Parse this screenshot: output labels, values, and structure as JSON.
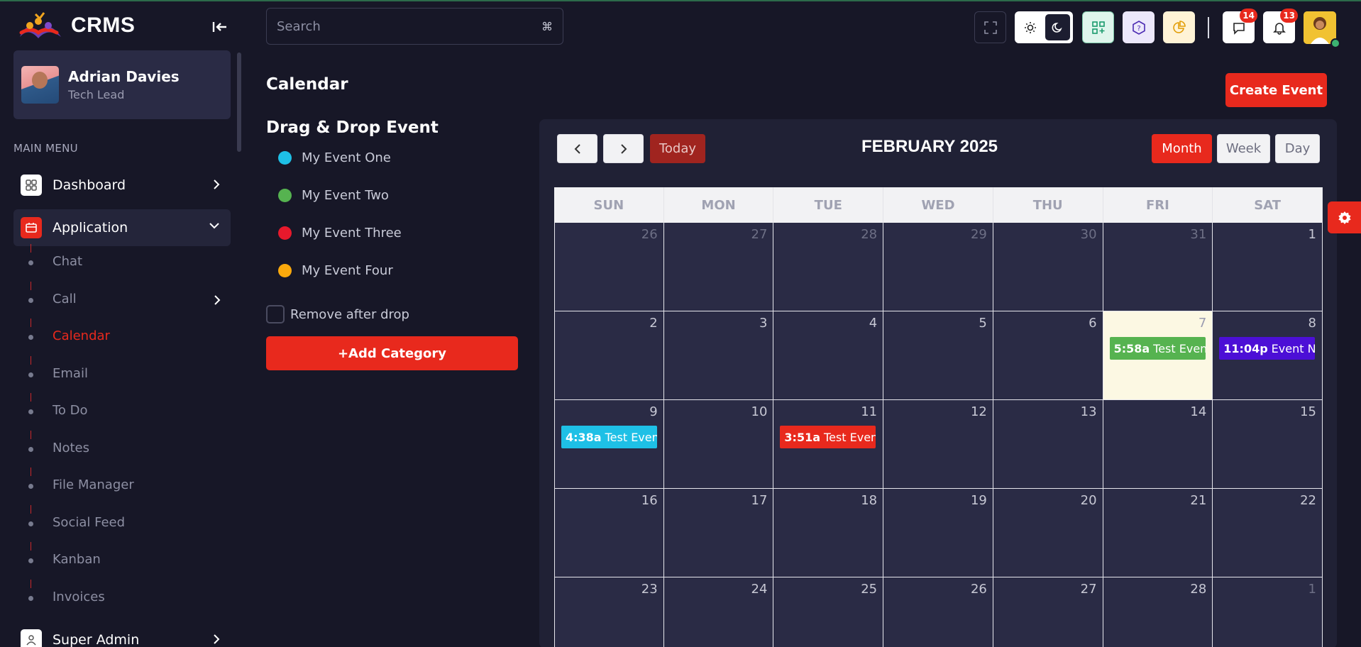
{
  "brand": {
    "name": "CRMS"
  },
  "profile": {
    "name": "Adrian Davies",
    "role": "Tech Lead"
  },
  "sidebar": {
    "section_title": "MAIN MENU",
    "items": [
      {
        "label": "Dashboard",
        "icon": "dashboard-icon"
      },
      {
        "label": "Application",
        "icon": "application-icon"
      },
      {
        "label": "Super Admin",
        "icon": "super-admin-icon"
      }
    ],
    "submenu": [
      {
        "label": "Chat"
      },
      {
        "label": "Call"
      },
      {
        "label": "Calendar"
      },
      {
        "label": "Email"
      },
      {
        "label": "To Do"
      },
      {
        "label": "Notes"
      },
      {
        "label": "File Manager"
      },
      {
        "label": "Social Feed"
      },
      {
        "label": "Kanban"
      },
      {
        "label": "Invoices"
      }
    ]
  },
  "search": {
    "placeholder": "Search",
    "shortcut": "⌘"
  },
  "topbar": {
    "messages_count": "14",
    "notifications_count": "13",
    "colors": {
      "accent": "#e8291d"
    }
  },
  "page": {
    "title": "Calendar",
    "create_button": "Create Event"
  },
  "drag_drop": {
    "title": "Drag & Drop Event",
    "events": [
      {
        "label": "My Event One",
        "color": "#1ec0e6"
      },
      {
        "label": "My Event Two",
        "color": "#56b350"
      },
      {
        "label": "My Event Three",
        "color": "#e8192c"
      },
      {
        "label": "My Event Four",
        "color": "#fba90c"
      }
    ],
    "remove_label": "Remove after drop",
    "add_category": "+Add Category"
  },
  "calendar": {
    "month_title": "FEBRUARY 2025",
    "today_label": "Today",
    "views": [
      "Month",
      "Week",
      "Day"
    ],
    "active_view": "Month",
    "weekdays": [
      "SUN",
      "MON",
      "TUE",
      "WED",
      "THU",
      "FRI",
      "SAT"
    ],
    "weeks": [
      [
        "26",
        "27",
        "28",
        "29",
        "30",
        "31",
        "1"
      ],
      [
        "2",
        "3",
        "4",
        "5",
        "6",
        "7",
        "8"
      ],
      [
        "9",
        "10",
        "11",
        "12",
        "13",
        "14",
        "15"
      ],
      [
        "16",
        "17",
        "18",
        "19",
        "20",
        "21",
        "22"
      ],
      [
        "23",
        "24",
        "25",
        "26",
        "27",
        "28",
        "1"
      ]
    ],
    "events": [
      {
        "day": "7",
        "week": 1,
        "col": 5,
        "time": "5:58a",
        "title": "Test Event",
        "color": "#56b350"
      },
      {
        "day": "8",
        "week": 1,
        "col": 6,
        "time": "11:04p",
        "title": "Event Na",
        "color": "#4c0fd6"
      },
      {
        "day": "9",
        "week": 2,
        "col": 0,
        "time": "4:38a",
        "title": "Test Event",
        "color": "#1ec0e6"
      },
      {
        "day": "11",
        "week": 2,
        "col": 2,
        "time": "3:51a",
        "title": "Test Event",
        "color": "#e8291d"
      }
    ]
  }
}
